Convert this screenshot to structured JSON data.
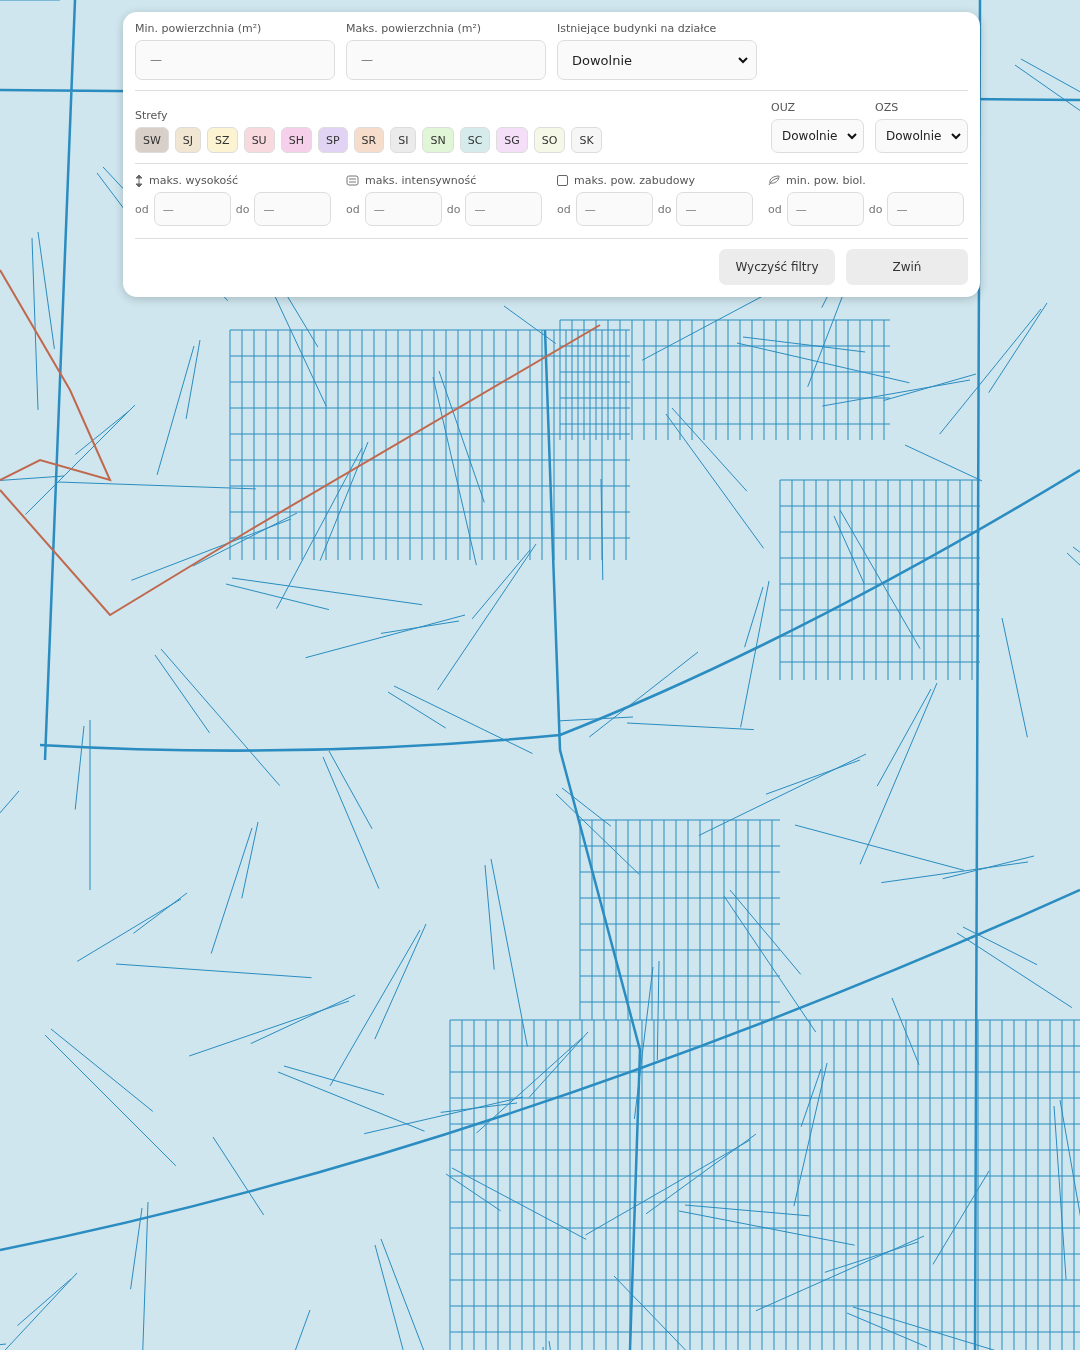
{
  "filters": {
    "area_fields": [
      {
        "label": "Min. powierzchnia (m²)",
        "placeholder": "—"
      },
      {
        "label": "Maks. powierzchnia (m²)",
        "placeholder": "—"
      }
    ],
    "buildings": {
      "label": "Istniejące budynki na działce",
      "value": "Dowolnie"
    },
    "zones": {
      "label": "Strefy",
      "items": [
        {
          "label": "SW",
          "color": "#d9cfc9"
        },
        {
          "label": "SJ",
          "color": "#f1e6d2"
        },
        {
          "label": "SZ",
          "color": "#fbf3d2"
        },
        {
          "label": "SU",
          "color": "#f8d9de"
        },
        {
          "label": "SH",
          "color": "#f6d0ea"
        },
        {
          "label": "SP",
          "color": "#e1d3f3"
        },
        {
          "label": "SR",
          "color": "#f5dccb"
        },
        {
          "label": "SI",
          "color": "#ebebeb"
        },
        {
          "label": "SN",
          "color": "#e1f6d6"
        },
        {
          "label": "SC",
          "color": "#d6ecec"
        },
        {
          "label": "SG",
          "color": "#f5def7"
        },
        {
          "label": "SO",
          "color": "#f6f8e7"
        },
        {
          "label": "SK",
          "color": "#f6f6f6"
        }
      ]
    },
    "selects": [
      {
        "label": "OUZ",
        "value": "Dowolnie"
      },
      {
        "label": "OZS",
        "value": "Dowolnie"
      }
    ],
    "ranges": [
      {
        "kind": "height",
        "label": "maks. wysokość",
        "from_label": "od",
        "from_placeholder": "—",
        "to_label": "do",
        "to_placeholder": "—"
      },
      {
        "kind": "building",
        "label": "maks. intensywność",
        "from_label": "od",
        "from_placeholder": "—",
        "to_label": "do",
        "to_placeholder": "—"
      },
      {
        "kind": "square",
        "label": "maks. pow. zabudowy",
        "from_label": "od",
        "from_placeholder": "—",
        "to_label": "do",
        "to_placeholder": "—"
      },
      {
        "kind": "leaf",
        "label": "min. pow. biol.",
        "from_label": "od",
        "from_placeholder": "—",
        "to_label": "do",
        "to_placeholder": "—"
      }
    ],
    "buttons": [
      "Wyczyść filtry",
      "Zwiń"
    ]
  }
}
